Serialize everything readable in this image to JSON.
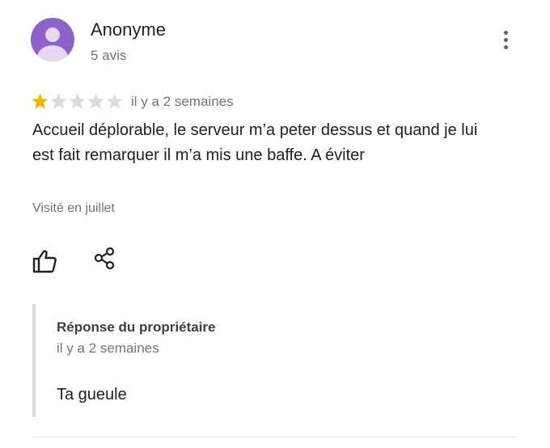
{
  "author": {
    "name": "Anonyme",
    "meta": "5 avis",
    "avatar_color": "#8e63c9"
  },
  "menu": {
    "icon": "more-vert-icon"
  },
  "review": {
    "rating": 1,
    "max_rating": 5,
    "star_filled_color": "#f4b400",
    "star_empty_color": "#dadce0",
    "date": "il y a 2 semaines",
    "text": "Accueil déplorable, le serveur m’a peter dessus et quand je lui est fait remarquer il m’a mis une baffe. A éviter",
    "visit": "Visité en juillet"
  },
  "actions": {
    "like_icon": "thumb-up-icon",
    "share_icon": "share-icon"
  },
  "owner_response": {
    "title": "Réponse du propriétaire",
    "date": "il y a 2 semaines",
    "text": "Ta gueule"
  }
}
